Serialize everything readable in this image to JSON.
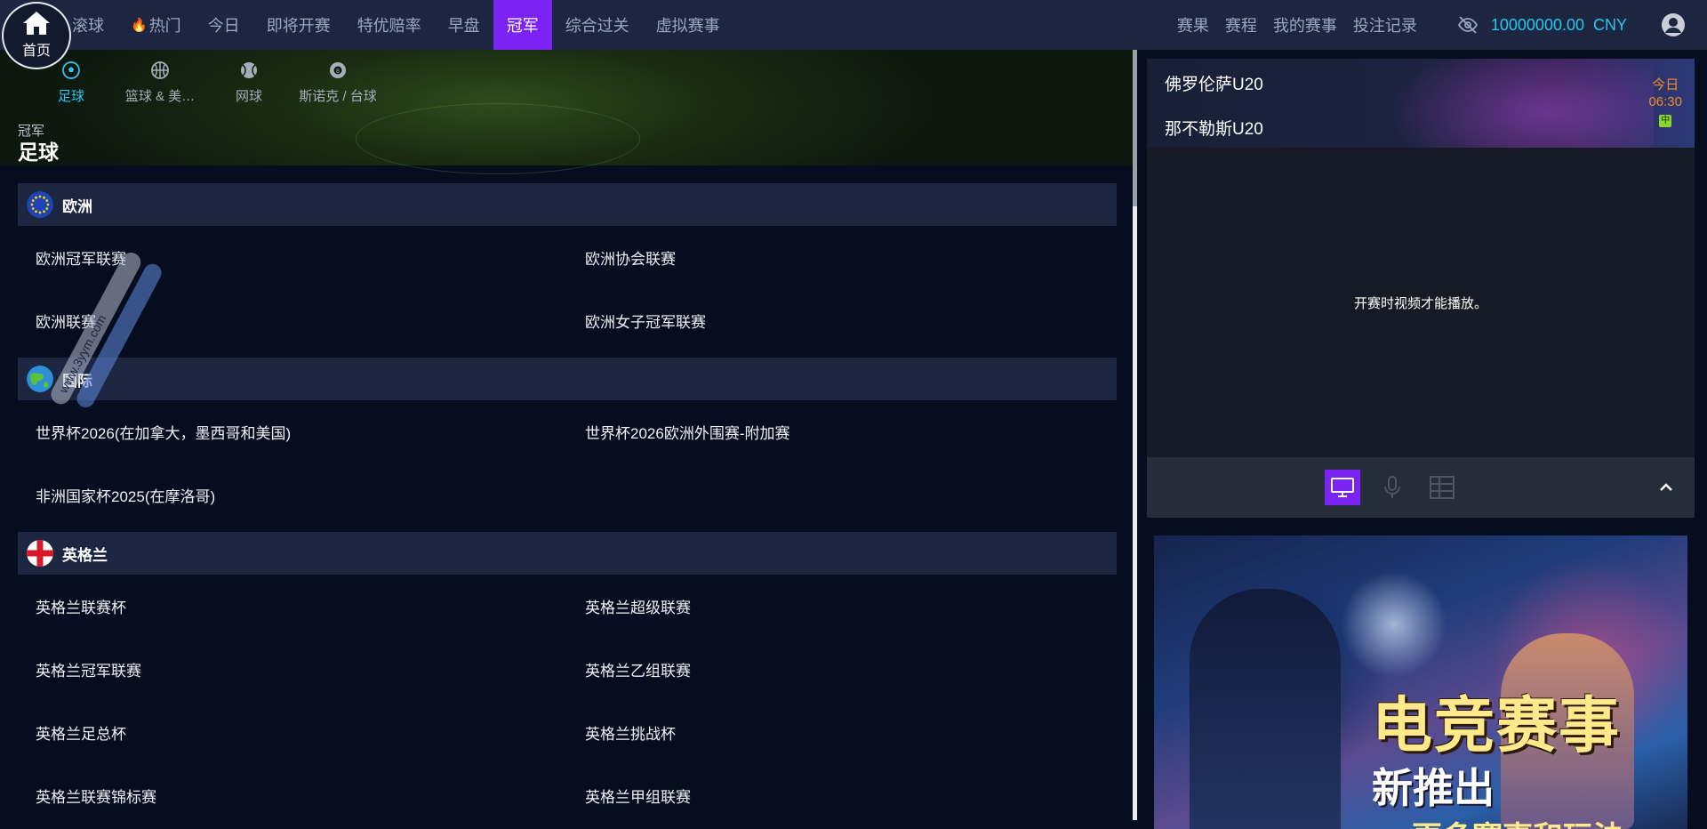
{
  "nav": {
    "home_label": "首页",
    "items": [
      {
        "label": "滚球"
      },
      {
        "label": "热门",
        "fire": true
      },
      {
        "label": "今日"
      },
      {
        "label": "即将开赛"
      },
      {
        "label": "特优赔率"
      },
      {
        "label": "早盘"
      },
      {
        "label": "冠军",
        "active": true
      },
      {
        "label": "综合过关"
      },
      {
        "label": "虚拟赛事"
      }
    ],
    "right_items": [
      "赛果",
      "赛程",
      "我的赛事",
      "投注记录"
    ],
    "balance": "10000000.00",
    "currency": "CNY",
    "accent_color": "#7b23f5",
    "balance_color": "#29c6f0"
  },
  "sports": [
    {
      "label": "足球",
      "icon": "soccer-ball-icon",
      "active": true
    },
    {
      "label": "篮球 & 美…",
      "icon": "basketball-icon"
    },
    {
      "label": "网球",
      "icon": "tennis-ball-icon"
    },
    {
      "label": "斯诺克 / 台球",
      "icon": "billiard-ball-icon"
    }
  ],
  "breadcrumb": "冠军",
  "section_title": "足球",
  "regions": [
    {
      "name": "欧洲",
      "flag": "eu-flag-icon",
      "leagues": [
        "欧洲冠军联赛",
        "欧洲协会联赛",
        "欧洲联赛",
        "欧洲女子冠军联赛"
      ]
    },
    {
      "name": "国际",
      "flag": "globe-icon",
      "leagues": [
        "世界杯2026(在加拿大，墨西哥和美国)",
        "世界杯2026欧洲外围赛-附加赛",
        "非洲国家杯2025(在摩洛哥)"
      ]
    },
    {
      "name": "英格兰",
      "flag": "england-flag-icon",
      "leagues": [
        "英格兰联赛杯",
        "英格兰超级联赛",
        "英格兰冠军联赛",
        "英格兰乙组联赛",
        "英格兰足总杯",
        "英格兰挑战杯",
        "英格兰联赛锦标赛",
        "英格兰甲组联赛"
      ]
    }
  ],
  "match": {
    "team1": "佛罗伦萨U20",
    "team2": "那不勒斯U20",
    "day": "今日",
    "time": "06:30",
    "badge": "中"
  },
  "video_message": "开赛时视频才能播放。",
  "ad": {
    "headline": "电竞赛事",
    "sub": "新推出",
    "sub2": "更多赛事和玩法"
  },
  "watermark": "www.3yym.com"
}
